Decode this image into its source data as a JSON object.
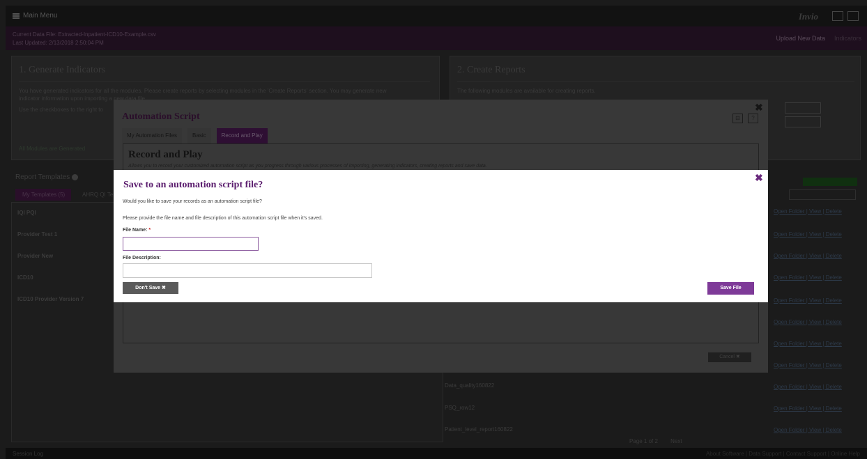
{
  "app": {
    "menu_label": "Main Menu",
    "brand": "Invio"
  },
  "data_file": {
    "line1": "Current Data File: Extracted-Inpatient-ICD10-Example.csv",
    "line2": "Last Updated: 2/13/2018 2:50:04 PM",
    "upload_label": "Upload New Data",
    "indicators_label": "Indicators"
  },
  "panel1": {
    "title": "1. Generate Indicators",
    "text1": "You have generated indicators for all the modules. Please create reports by selecting modules in the 'Create Reports' section. You may generate new",
    "text2": "indicator information upon importing a new data file.",
    "text3": "Use the checkboxes to the right to",
    "link": "All Modules are Generated"
  },
  "panel2": {
    "title": "2. Create Reports",
    "text1": "The following modules are available for creating reports."
  },
  "report_templates": {
    "heading": "Report Templates",
    "tabs": [
      "My Templates (5)",
      "AHRQ QI Te"
    ],
    "rows": [
      "IQI PQI",
      "Provider Test 1",
      "Provider New",
      "ICD10",
      "ICD10 Provider Version 7"
    ]
  },
  "reports": {
    "rows": [
      "Data_quality160822",
      "PSQ_row12",
      "Patient_level_report160822"
    ],
    "link_text": "Open Folder | View | Delete",
    "pager": "Page 1 of 2",
    "next": "Next",
    "new_button": "New Re...",
    "filter": "Filter"
  },
  "footer": {
    "left": "Session Log",
    "right": "About Software | Data Support | Contact Support | Online Help"
  },
  "automation_modal": {
    "title": "Automation Script",
    "tabs": [
      "My Automation Files",
      "Basic",
      "Record and Play"
    ],
    "active_tab": 2,
    "section_title": "Record and Play",
    "section_desc": "Allows you to record your customized automation script as you progress through various processes of importing, generating indicators, creating reports and save data.",
    "cancel": "Cancel ✖",
    "close_icon": "✖",
    "icons": [
      "⊟",
      "?"
    ]
  },
  "save_dialog": {
    "title": "Save to an automation script file?",
    "question": "Would you like to save your records as an automation script file?",
    "instruction": "Please provide the file name and file description of this automation script file when it's saved.",
    "file_name_label": "File Name:",
    "required_mark": "*",
    "file_name_value": "",
    "file_description_label": "File Description:",
    "file_description_value": "",
    "dont_save": "Don't Save ✖",
    "save": "Save File",
    "close_icon": "✖",
    "accent_color": "#7e3a98"
  }
}
